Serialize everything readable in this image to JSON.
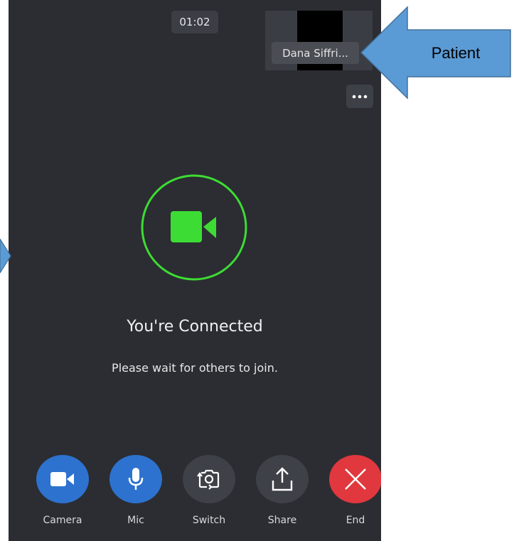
{
  "call": {
    "timer": "01:02",
    "participant_name": "Dana Siffri...",
    "status_title": "You're Connected",
    "status_message": "Please wait for others to join."
  },
  "controls": [
    {
      "label": "Camera",
      "icon": "video-camera-icon",
      "color": "#2d72cf"
    },
    {
      "label": "Mic",
      "icon": "microphone-icon",
      "color": "#2d72cf"
    },
    {
      "label": "Switch",
      "icon": "switch-camera-icon",
      "color": "#3e4147"
    },
    {
      "label": "Share",
      "icon": "share-icon",
      "color": "#3e4147"
    },
    {
      "label": "End",
      "icon": "close-x-icon",
      "color": "#e0383e"
    }
  ],
  "annotation": {
    "label": "Patient",
    "arrow_color": "#5b9bd5"
  },
  "colors": {
    "background": "#2b2d32",
    "connected_green": "#3ddc34"
  }
}
